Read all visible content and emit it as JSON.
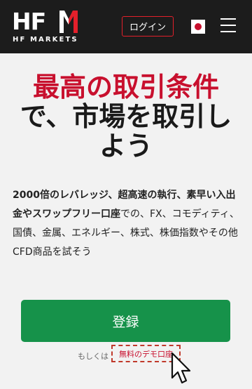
{
  "header": {
    "logo_mark": "HF",
    "logo_sub": "HF MARKETS",
    "login_label": "ログイン",
    "flag_icon": "japan-flag-icon",
    "menu_icon": "hamburger-menu-icon",
    "colors": {
      "background": "#1c1c1c",
      "accent": "#e3202b"
    }
  },
  "hero": {
    "line1": "最高の取引条件",
    "line2": "で、市場を取引し",
    "line3": "よう",
    "colors": {
      "highlight": "#c8102e"
    }
  },
  "description": {
    "bold": "2000倍のレバレッジ、超高速の執行、素早い入出金やスワップフリー口座",
    "rest": "での、FX、コモディティ、国債、金属、エネルギー、株式、株価指数やその他CFD商品を試そう"
  },
  "cta": {
    "register_label": "登録",
    "or_label": "もしくは",
    "demo_label": "無料のデモ口座",
    "colors": {
      "register": "#16924a"
    }
  },
  "cursor_icon": "mouse-pointer-icon"
}
